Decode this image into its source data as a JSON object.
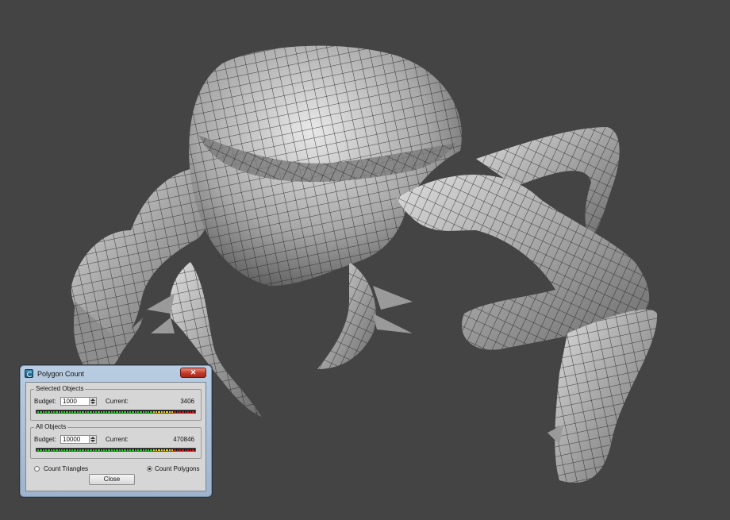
{
  "dialog": {
    "title": "Polygon Count",
    "close_glyph": "✕",
    "selected": {
      "label": "Selected Objects",
      "budget_label": "Budget:",
      "budget_value": "1000",
      "current_label": "Current:",
      "current_value": "3406",
      "meter_level": 1.0
    },
    "all": {
      "label": "All Objects",
      "budget_label": "Budget:",
      "budget_value": "10000",
      "current_label": "Current:",
      "current_value": "470846",
      "meter_level": 1.0
    },
    "count_triangles_label": "Count Triangles",
    "count_polygons_label": "Count Polygons",
    "selected_mode": "polygons",
    "close_button_label": "Close"
  },
  "colors": {
    "viewport_bg": "#444444",
    "mesh_fill": "#b8b8b8",
    "mesh_wire": "#1a1a1a",
    "meter_green": "#2ecc2e",
    "meter_yellow": "#e6d21a",
    "meter_red": "#d01818"
  },
  "icons": {
    "app_icon": "3dsmax-icon",
    "close": "close-icon"
  }
}
